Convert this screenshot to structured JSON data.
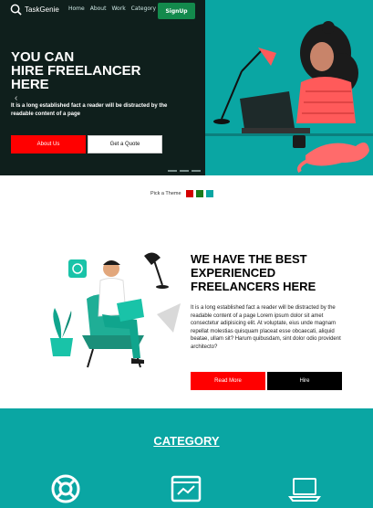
{
  "nav": {
    "logo_text": "TaskGenie",
    "links": [
      "Home",
      "About",
      "Work",
      "Category"
    ],
    "signup_label": "SignUp"
  },
  "hero": {
    "title_lines": [
      "YOU CAN",
      "HIRE FREELANCER",
      "HERE"
    ],
    "description": "It is a long established fact a reader will be distracted by the readable content of a page",
    "about_label": "About Us",
    "quote_label": "Get a Quote"
  },
  "theme": {
    "label": "Pick a Theme",
    "swatches": [
      "#d40000",
      "#1a7a1a",
      "#0aa6a3"
    ]
  },
  "about": {
    "title_lines": [
      "WE HAVE THE BEST",
      "EXPERIENCED",
      "FREELANCERS HERE"
    ],
    "description": "It is a long established fact a reader will be distracted by the readable content of a page Lorem ipsum dolor sit amet consectetur adipisicing elit. At voluptate, eius unde magnam repellat molestias quisquam placeat esse obcaecati, aliquid beatae, ullam sit? Harum quibusdam, sint dolor odio provident architecto?",
    "read_more_label": "Read More",
    "hire_label": "Hire"
  },
  "category": {
    "title": "CATEGORY",
    "icons": [
      "lifebuoy-icon",
      "browser-analytics-icon",
      "laptop-icon"
    ]
  },
  "colors": {
    "teal": "#0aa6a3",
    "dark": "#0f1f1c",
    "red": "#ff0000",
    "green": "#138a4c"
  }
}
